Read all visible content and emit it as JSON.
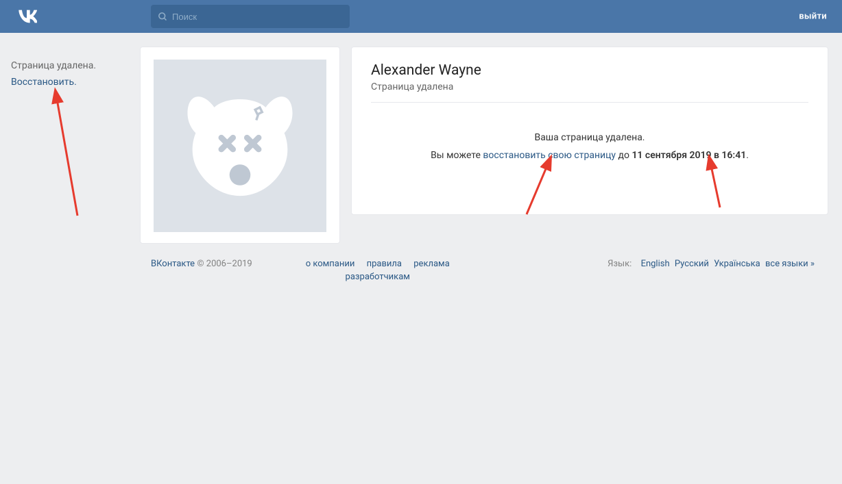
{
  "header": {
    "search_placeholder": "Поиск",
    "logout": "выйти"
  },
  "sidebar": {
    "status": "Страница удалена.",
    "restore": "Восстановить."
  },
  "profile": {
    "name": "Alexander Wayne",
    "status": "Страница удалена"
  },
  "message": {
    "title": "Ваша страница удалена.",
    "line_prefix": "Вы можете ",
    "restore_link": "восстановить свою страницу",
    "mid": " до ",
    "deadline": "11 сентября 2019 в 16:41",
    "suffix": "."
  },
  "footer": {
    "brand": "ВКонтакте",
    "copyright": " © 2006–2019",
    "links": {
      "about": "о компании",
      "rules": "правила",
      "ads": "реклама",
      "devs": "разработчикам"
    },
    "lang_label": "Язык:",
    "langs": {
      "en": "English",
      "ru": "Русский",
      "ua": "Українська",
      "all": "все языки »"
    }
  }
}
